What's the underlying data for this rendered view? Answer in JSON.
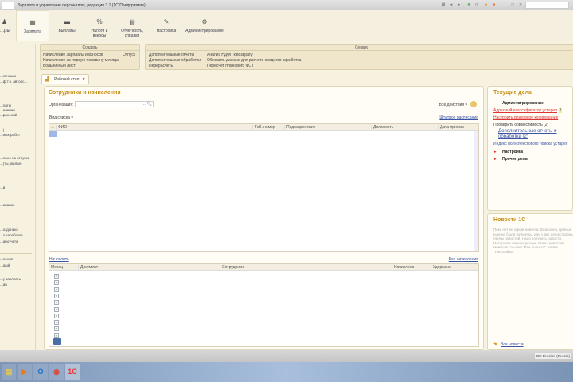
{
  "window": {
    "title": "Зарплата и управление персоналом, редакция 3.1  (1С:Предприятие)"
  },
  "sections": [
    {
      "label": "...ры",
      "icon": "staff-icon"
    },
    {
      "label": "Зарплата",
      "icon": "calculator-icon"
    },
    {
      "label": "Выплаты",
      "icon": "wallet-icon"
    },
    {
      "label": "Налоги и взносы",
      "icon": "percent-icon"
    },
    {
      "label": "Отчетность, справки",
      "icon": "reports-icon"
    },
    {
      "label": "Настройка",
      "icon": "wrench-icon"
    },
    {
      "label": "Администрирование",
      "icon": "gear-icon"
    }
  ],
  "create_panel": {
    "title": "Создать",
    "items": [
      "Начисление зарплаты и взносов",
      "Начисление за первую половину месяца",
      "Больничный лист",
      "Отпуск"
    ]
  },
  "service_panel": {
    "title": "Сервис",
    "items": [
      "Дополнительные отчеты",
      "Дополнительные обработки",
      "Перерасчеты",
      "Анализ НДФЛ к возврату",
      "Обновить данные для расчета среднего заработка",
      "Пересчет планового ФОТ"
    ]
  },
  "sidebar": {
    "items": [
      "...личным",
      "...ф т.ч. авторс...",
      "...латы",
      "...еления",
      "...ранений",
      "...)",
      "...ных работ",
      "...льно на отпуска",
      "...(ты, жилье)",
      "...и",
      "...ивание",
      "...озданию",
      "...о заработка",
      "...аботчета",
      "...ления",
      "...дый",
      "...у зарплаты",
      "...ая"
    ]
  },
  "tab": {
    "label": "Рабочий стол",
    "close": "✕"
  },
  "employees": {
    "title": "Сотрудники и начисления",
    "org_label": "Организация:",
    "org_value": "",
    "all_actions": "Все действия ▾",
    "list_view": "Вид списка ▾",
    "staff_link": "Штатное расписание",
    "columns": [
      "ФИО",
      "Таб. номер",
      "Подразделение",
      "Должность",
      "Дата приема"
    ]
  },
  "accruals": {
    "calc_link": "Начислить",
    "all_link": "Все начисления",
    "columns": [
      "Месяц",
      "Документ",
      "Сотрудники",
      "Начислено",
      "Удержано"
    ],
    "rows": 10
  },
  "current": {
    "title": "Текущие дела",
    "groups": [
      "Администрирование",
      "Настройка",
      "Прочие дела"
    ],
    "items": [
      "Адресный классификатор устарел",
      "Настроить резервное копирование",
      "Проверить совместимость (2)",
      "Дополнительные отчеты и обработки (2)",
      "Индекс полнотекстового поиска устарел"
    ],
    "badge": "!"
  },
  "news": {
    "title": "Новости 1С",
    "text": "Пока нет ни одной новости. Возможно, данные еще не были получены, или у вас не настроены ленты новостей. Надо получить новости. Настроить интересующие ленты новостей можно по ссылке \"Все новости\", затем \"Настройки\".",
    "all_link": "Все новости"
  },
  "status": {
    "language": "RU Russian (Russia)"
  },
  "taskbar": [
    {
      "name": "explorer",
      "glyph": "▤",
      "color": "#e8c84a"
    },
    {
      "name": "media-player",
      "glyph": "▶",
      "color": "#e67a1e"
    },
    {
      "name": "outlook",
      "glyph": "O",
      "color": "#1e6fc8"
    },
    {
      "name": "chrome",
      "glyph": "◉",
      "color": "#d43"
    },
    {
      "name": "1c",
      "glyph": "1С",
      "color": "#e33"
    }
  ]
}
